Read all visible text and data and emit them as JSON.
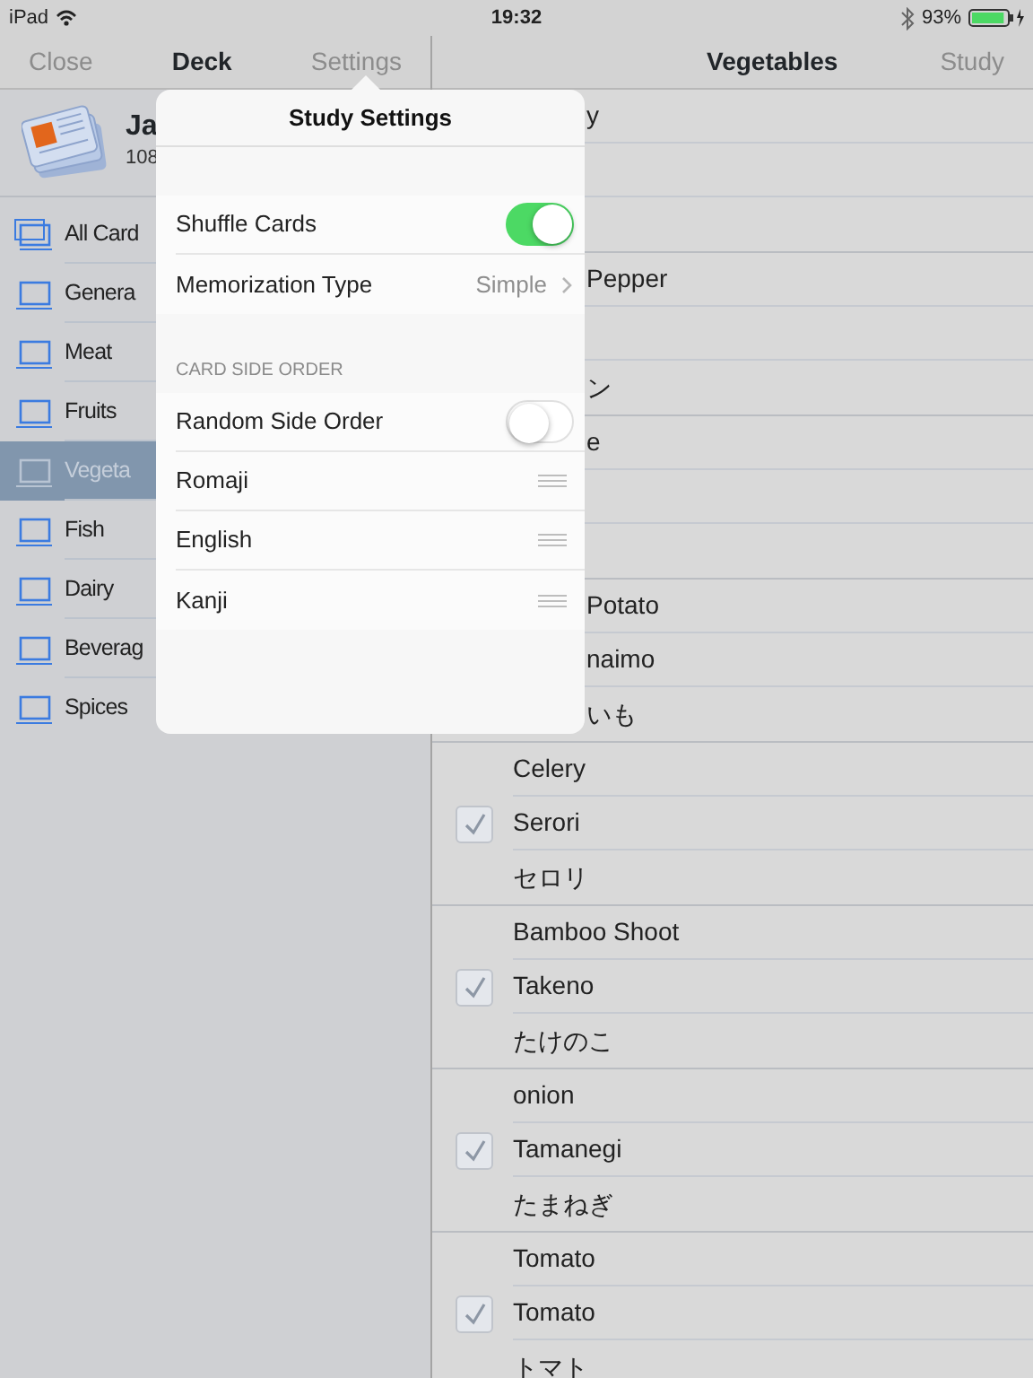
{
  "status_bar": {
    "device": "iPad",
    "time": "19:32",
    "battery": "93%"
  },
  "deck_nav": {
    "left": "Close",
    "title": "Deck",
    "right": "Settings"
  },
  "list_nav": {
    "title": "Vegetables",
    "right": "Study"
  },
  "deck": {
    "name": "Ja",
    "count": "108"
  },
  "categories": [
    {
      "label": "All Card",
      "kind": "all",
      "selected": false
    },
    {
      "label": "Genera",
      "kind": "single",
      "selected": false
    },
    {
      "label": "Meat",
      "kind": "single",
      "selected": false
    },
    {
      "label": "Fruits",
      "kind": "single",
      "selected": false
    },
    {
      "label": "Vegeta",
      "kind": "single",
      "selected": true
    },
    {
      "label": "Fish",
      "kind": "single",
      "selected": false
    },
    {
      "label": "Dairy",
      "kind": "single",
      "selected": false
    },
    {
      "label": "Beverag",
      "kind": "single",
      "selected": false
    },
    {
      "label": "Spices",
      "kind": "single",
      "selected": false
    }
  ],
  "popover": {
    "title": "Study Settings",
    "sections": [
      {
        "rows": [
          {
            "kind": "toggle",
            "label": "Shuffle Cards",
            "on": true
          },
          {
            "kind": "disclosure",
            "label": "Memorization Type",
            "value": "Simple"
          }
        ]
      },
      {
        "header": "CARD SIDE ORDER",
        "rows": [
          {
            "kind": "toggle",
            "label": "Random Side Order",
            "on": false
          },
          {
            "kind": "reorder",
            "label": "Romaji"
          },
          {
            "kind": "reorder",
            "label": "English"
          },
          {
            "kind": "reorder",
            "label": "Kanji"
          }
        ]
      }
    ]
  },
  "cards": [
    {
      "covered": true,
      "rows": [
        {
          "text": "y"
        },
        {},
        {}
      ]
    },
    {
      "covered": true,
      "rows": [
        {
          "text": "Pepper"
        },
        {},
        {
          "text": "ン"
        }
      ]
    },
    {
      "covered": true,
      "rows": [
        {
          "text": "e"
        },
        {},
        {}
      ]
    },
    {
      "covered": true,
      "rows": [
        {
          "text": "Potato"
        },
        {
          "text": "naimo"
        },
        {
          "text": "いも"
        }
      ]
    },
    {
      "covered": false,
      "rows": [
        {
          "text": "Celery"
        },
        {
          "text": "Serori",
          "checked": true
        },
        {
          "text": "セロリ"
        }
      ]
    },
    {
      "covered": false,
      "rows": [
        {
          "text": "Bamboo Shoot"
        },
        {
          "text": "Takeno",
          "checked": true
        },
        {
          "text": "たけのこ"
        }
      ]
    },
    {
      "covered": false,
      "rows": [
        {
          "text": "onion"
        },
        {
          "text": "Tamanegi",
          "checked": true
        },
        {
          "text": "たまねぎ"
        }
      ]
    },
    {
      "covered": false,
      "rows": [
        {
          "text": "Tomato"
        },
        {
          "text": "Tomato",
          "checked": true
        },
        {
          "text": "トマト"
        }
      ]
    }
  ]
}
